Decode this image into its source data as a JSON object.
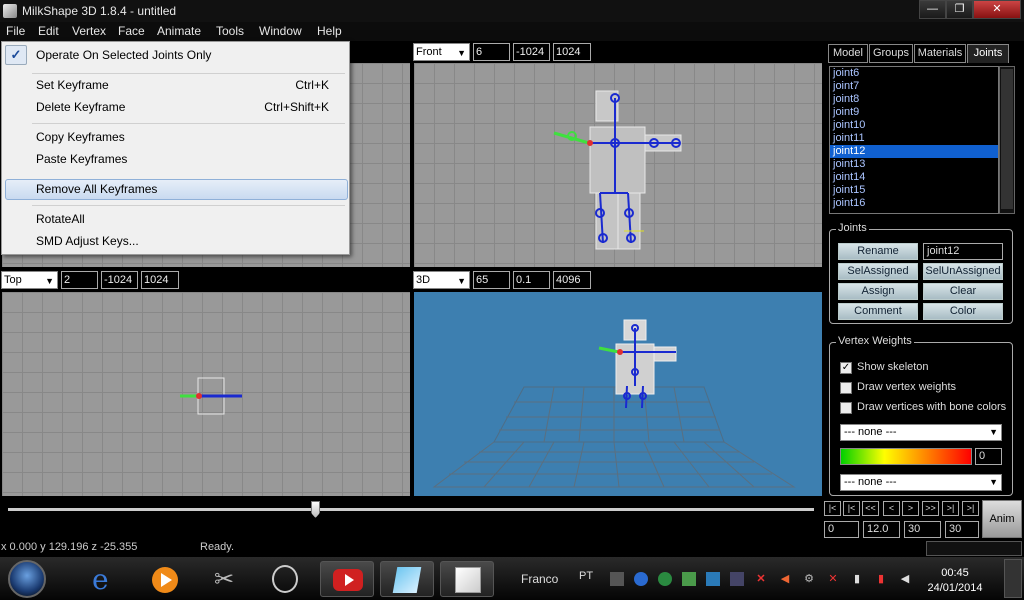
{
  "window": {
    "title": "MilkShape 3D 1.8.4 - untitled",
    "minimize": "—",
    "maximize": "❐",
    "close": "✕"
  },
  "menubar": [
    "File",
    "Edit",
    "Vertex",
    "Face",
    "Animate",
    "Tools",
    "Window",
    "Help"
  ],
  "animate_menu": {
    "checkmark": "✓",
    "items": [
      {
        "label": "Operate On Selected Joints Only",
        "shortcut": ""
      },
      {
        "label": "Set Keyframe",
        "shortcut": "Ctrl+K"
      },
      {
        "label": "Delete Keyframe",
        "shortcut": "Ctrl+Shift+K"
      },
      {
        "label": "Copy Keyframes",
        "shortcut": ""
      },
      {
        "label": "Paste Keyframes",
        "shortcut": ""
      },
      {
        "label": "Remove All Keyframes",
        "shortcut": ""
      },
      {
        "label": "RotateAll",
        "shortcut": ""
      },
      {
        "label": "SMD Adjust Keys...",
        "shortcut": ""
      }
    ]
  },
  "viewports": {
    "front": {
      "view": "Front",
      "zoom": "6",
      "near": "-1024",
      "far": "1024"
    },
    "top": {
      "view": "Top",
      "zoom": "2",
      "near": "-1024",
      "far": "1024"
    },
    "three_d": {
      "view": "3D",
      "fov": "65",
      "near": "0.1",
      "far": "4096"
    }
  },
  "panel": {
    "tabs": [
      "Model",
      "Groups",
      "Materials",
      "Joints"
    ],
    "active_tab": "Joints",
    "joints": [
      "joint6",
      "joint7",
      "joint8",
      "joint9",
      "joint10",
      "joint11",
      "joint12",
      "joint13",
      "joint14",
      "joint15",
      "joint16"
    ],
    "selected_joint": "joint12",
    "joints_group": {
      "title": "Joints",
      "rename": "Rename",
      "name_value": "joint12",
      "sel_assigned": "SelAssigned",
      "sel_unassigned": "SelUnAssigned",
      "assign": "Assign",
      "clear": "Clear",
      "comment": "Comment",
      "color": "Color"
    },
    "vertex_weights": {
      "title": "Vertex Weights",
      "show_skeleton": "Show skeleton",
      "draw_vertex_weights": "Draw vertex weights",
      "draw_vertices_bone_colors": "Draw vertices with bone colors",
      "combo1": "--- none ---",
      "weight_value": "0",
      "combo2": "--- none ---"
    }
  },
  "timeline": {
    "nav": [
      "|<",
      "|<",
      "<<",
      "<",
      ">",
      ">>",
      ">|",
      ">|"
    ],
    "fields": [
      "0",
      "12.0",
      "30",
      "30"
    ],
    "anim": "Anim",
    "position": 0.4
  },
  "status": {
    "coords": "x 0.000 y 129.196 z -25.355",
    "message": "Ready."
  },
  "taskbar": {
    "user": "Franco",
    "lang": "PT",
    "time": "00:45",
    "date": "24/01/2014"
  }
}
